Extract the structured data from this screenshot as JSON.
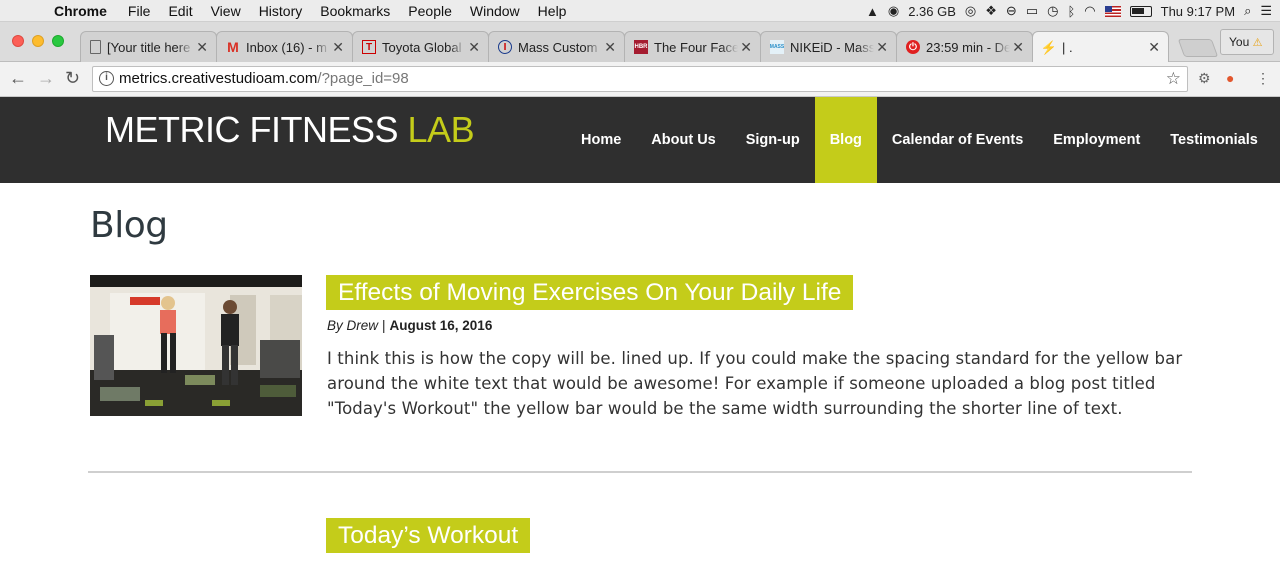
{
  "menubar": {
    "app_name": "Chrome",
    "items": [
      "File",
      "Edit",
      "View",
      "History",
      "Bookmarks",
      "People",
      "Window",
      "Help"
    ],
    "memory": "2.36 GB",
    "clock": "Thu 9:17 PM"
  },
  "browser": {
    "tabs": [
      {
        "title": "[Your title here",
        "icon": "document-icon"
      },
      {
        "title": "Inbox (16) - m",
        "icon": "gmail-icon"
      },
      {
        "title": "Toyota Global",
        "icon": "toyota-icon"
      },
      {
        "title": "Mass Custom",
        "icon": "mass-custom-icon"
      },
      {
        "title": "The Four Face",
        "icon": "hbr-icon"
      },
      {
        "title": "NIKEiD - Mass",
        "icon": "nike-icon"
      },
      {
        "title": "23:59 min - De",
        "icon": "timer-icon"
      },
      {
        "title": "| .",
        "icon": "bolt-icon"
      }
    ],
    "profile_label": "You",
    "url_host": "metrics.creativestudioam.com",
    "url_path": "/?page_id=98"
  },
  "site": {
    "logo_main": "METRIC FITNESS",
    "logo_accent": "LAB",
    "nav": [
      "Home",
      "About Us",
      "Sign-up",
      "Blog",
      "Calendar of Events",
      "Employment",
      "Testimonials"
    ],
    "active_nav": "Blog",
    "accent_color": "#c4cc1a",
    "header_bg": "#2f2f2f"
  },
  "page": {
    "title": "Blog",
    "posts": [
      {
        "title": "Effects of Moving Exercises On Your Daily Life",
        "author_prefix": "By Drew",
        "separator": "|",
        "date": "August 16, 2016",
        "excerpt": "I think this is how the copy will be. lined up. If you could make the spacing standard for the yellow bar around the white text that would be awesome! For example if someone uploaded a blog post titled \"Today's Workout\" the yellow bar would be the same width surrounding the shorter line of text."
      },
      {
        "title": "Today’s Workout"
      }
    ]
  }
}
